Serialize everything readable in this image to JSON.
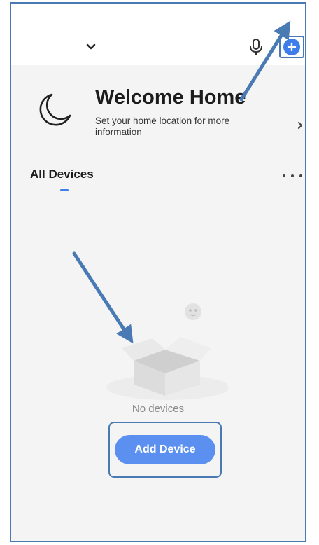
{
  "header": {
    "home_selector_icon": "chevron-down-icon",
    "mic_icon": "microphone-icon",
    "add_icon": "plus-circle-icon"
  },
  "welcome": {
    "title": "Welcome Home",
    "subtitle": "Set your home location for more information",
    "icon": "moon-icon"
  },
  "devices": {
    "tab_label": "All Devices",
    "more_icon": "more-horizontal-icon",
    "empty_text": "No devices",
    "add_device_label": "Add Device"
  },
  "colors": {
    "accent": "#3d7ee8",
    "button": "#5b8ff0",
    "annotation": "#4a7ab4",
    "background": "#f4f4f4"
  }
}
